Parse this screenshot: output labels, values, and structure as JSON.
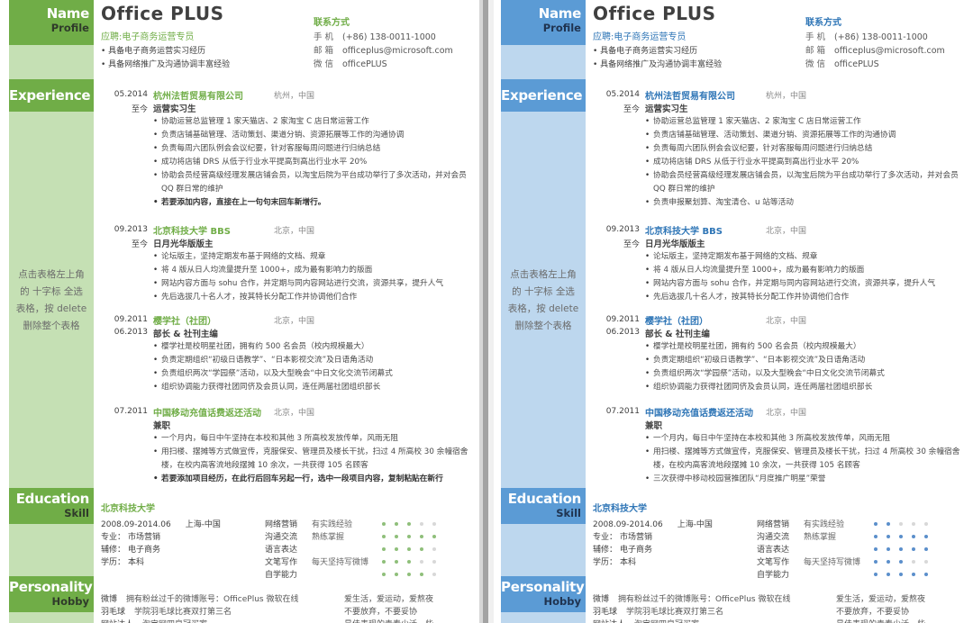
{
  "pages": [
    {
      "theme": "green",
      "accent_color": "#70ad47",
      "sidebar_color": "#c5e0b4",
      "sections": {
        "name": {
          "title": "Name",
          "subtitle": "Profile"
        },
        "experience": {
          "title": "Experience"
        },
        "education": {
          "title": "Education",
          "subtitle": "Skill"
        },
        "personality": {
          "title": "Personality",
          "subtitle": "Hobby"
        }
      },
      "sidebar_note": [
        "点击表格左上角",
        "的 十字标 全选",
        "表格，按 delete",
        "删除整个表格"
      ],
      "name": "Office PLUS",
      "job_target": "应聘:电子商务运营专员",
      "highlights": [
        "具备电子商务运营实习经历",
        "具备网络推广及沟通协调丰富经验"
      ],
      "contact": {
        "title": "联系方式",
        "rows": [
          {
            "label": "手 机",
            "value": "(+86) 138-0011-1000"
          },
          {
            "label": "邮 箱",
            "value": "officeplus@microsoft.com"
          },
          {
            "label": "微 信",
            "value": "officePLUS"
          }
        ]
      },
      "experience": [
        {
          "date_start": "05.2014",
          "date_end": "至今",
          "org": "杭州法哲贸易有限公司",
          "location": "杭州，中国",
          "role": "运营实习生",
          "bullets": [
            "协助运营总监管理 1 家天猫店、2 家淘宝 C 店日常运营工作",
            "负责店铺基础管理、活动策划、渠道分销、资源拓展等工作的沟通协调",
            "负责每周六团队例会会议纪要，针对客服每周问题进行归纳总结",
            "成功将店铺 DRS 从低于行业水平提高到高出行业水平 20%",
            "协助会员经营高级经理发展店铺会员，以淘宝后院为平台成功举行了多次活动，并对会员 QQ 群日常的维护",
            "若要添加内容，直接在上一句句末回车新增行。"
          ],
          "bold_last": true
        },
        {
          "date_start": "09.2013",
          "date_end": "至今",
          "org": "北京科技大学 BBS",
          "location": "北京，中国",
          "role": "日月光华版版主",
          "bullets": [
            "论坛版主，坚持定期发布基于网络的文档、规章",
            "将 4 版从日人均流量提升至 1000+，成为最有影响力的版面",
            "网站内容方面与 sohu 合作，并定期与同内容网站进行交流，资源共享，提升人气",
            "先后选拔几十名人才，按其特长分配工作并协调他们合作"
          ],
          "bold_last": false
        },
        {
          "date_start": "09.2011",
          "date_end": "06.2013",
          "org": "樱学社（社团）",
          "location": "北京，中国",
          "role": "部长 & 社刊主编",
          "bullets": [
            "樱学社是校明星社团，拥有约 500 名会员（校内规模最大）",
            "负责定期组织“初级日语教学”、“日本影视交流”及日语角活动",
            "负责组织两次“学园祭”活动，以及大型晚会“中日文化交流节闭幕式",
            "组织协调能力获得社团同侪及会员认同，连任两届社团组织部长"
          ],
          "bold_last": false
        },
        {
          "date_start": "07.2011",
          "date_end": "",
          "org": "中国移动充值话费返还活动",
          "location": "北京，中国",
          "role": "兼职",
          "bullets": [
            "一个月内，每日中午坚持在本校和其他 3 所高校发放传单，风雨无阻",
            "用扫楼、摆摊等方式做宣传，克服保安、管理员及楼长干扰，扫过 4 所高校 30 余幢宿舍楼，在校内高客流地段摆摊 10 余次，一共获得 105 名顾客",
            "若要添加项目经历，在此行后回车另起一行，选中一段项目内容，复制粘贴在新行"
          ],
          "bold_last": true
        }
      ],
      "education": {
        "school": "北京科技大学",
        "period": "2008.09-2014.06",
        "place": "上海-中国",
        "rows": [
          {
            "label": "专业：",
            "value": "市场营销"
          },
          {
            "label": "辅修：",
            "value": "电子商务"
          },
          {
            "label": "学历：",
            "value": "本科"
          }
        ]
      },
      "skills": [
        {
          "name": "网络营销",
          "desc": "有实践经验",
          "level": 3,
          "max": 5
        },
        {
          "name": "沟通交流",
          "desc": "熟练掌握",
          "level": 5,
          "max": 5
        },
        {
          "name": "语言表达",
          "desc": "",
          "level": 4,
          "max": 5
        },
        {
          "name": "文笔写作",
          "desc": "每天坚持写微博",
          "level": 3,
          "max": 5
        },
        {
          "name": "自学能力",
          "desc": "",
          "level": 4,
          "max": 5
        }
      ],
      "hobbies": [
        {
          "key": "微博",
          "value": "拥有粉丝过千的微博账号：OfficePlus 微软在线"
        },
        {
          "key": "羽毛球",
          "value": "学院羽毛球比赛双打第三名"
        },
        {
          "key": "网站达人",
          "value": "淘宝网四皇冠买家"
        }
      ],
      "personality": [
        "爱生活，爱运动，爱熬夜",
        "不要放弃，不要妥协",
        "最佳表现的青春少活一些"
      ]
    },
    {
      "theme": "blue",
      "accent_color": "#2e75b6",
      "sidebar_color": "#bdd7ee",
      "sections": {
        "name": {
          "title": "Name",
          "subtitle": "Profile"
        },
        "experience": {
          "title": "Experience"
        },
        "education": {
          "title": "Education",
          "subtitle": "Skill"
        },
        "personality": {
          "title": "Personality",
          "subtitle": "Hobby"
        }
      },
      "sidebar_note": [
        "点击表格左上角",
        "的 十字标 全选",
        "表格，按 delete",
        "删除整个表格"
      ],
      "name": "Office PLUS",
      "job_target": "应聘:电子商务运营专员",
      "highlights": [
        "具备电子商务运营实习经历",
        "具备网络推广及沟通协调丰富经验"
      ],
      "contact": {
        "title": "联系方式",
        "rows": [
          {
            "label": "手 机",
            "value": "(+86) 138-0011-1000"
          },
          {
            "label": "邮 箱",
            "value": "officeplus@microsoft.com"
          },
          {
            "label": "微 信",
            "value": "officePLUS"
          }
        ]
      },
      "experience": [
        {
          "date_start": "05.2014",
          "date_end": "至今",
          "org": "杭州法哲贸易有限公司",
          "location": "杭州，中国",
          "role": "运营实习生",
          "bullets": [
            "协助运营总监管理 1 家天猫店、2 家淘宝 C 店日常运营工作",
            "负责店铺基础管理、活动策划、渠道分销、资源拓展等工作的沟通协调",
            "负责每周六团队例会会议纪要，针对客服每周问题进行归纳总结",
            "成功将店铺 DRS 从低于行业水平提高到高出行业水平 20%",
            "协助会员经营高级经理发展店铺会员，以淘宝后院为平台成功举行了多次活动，并对会员 QQ 群日常的维护",
            "负责申报聚划算、淘宝清仓、u 站等活动"
          ],
          "bold_last": false
        },
        {
          "date_start": "09.2013",
          "date_end": "至今",
          "org": "北京科技大学 BBS",
          "location": "北京，中国",
          "role": "日月光华版版主",
          "bullets": [
            "论坛版主，坚持定期发布基于网络的文档、规章",
            "将 4 版从日人均流量提升至 1000+，成为最有影响力的版面",
            "网站内容方面与 sohu 合作，并定期与同内容网站进行交流，资源共享，提升人气",
            "先后选拔几十名人才，按其特长分配工作并协调他们合作"
          ],
          "bold_last": false
        },
        {
          "date_start": "09.2011",
          "date_end": "06.2013",
          "org": "樱学社（社团）",
          "location": "北京，中国",
          "role": "部长 & 社刊主编",
          "bullets": [
            "樱学社是校明星社团，拥有约 500 名会员（校内规模最大）",
            "负责定期组织“初级日语教学”、“日本影视交流”及日语角活动",
            "负责组织两次“学园祭”活动，以及大型晚会“中日文化交流节闭幕式",
            "组织协调能力获得社团同侪及会员认同，连任两届社团组织部长"
          ],
          "bold_last": false
        },
        {
          "date_start": "07.2011",
          "date_end": "",
          "org": "中国移动充值话费返还活动",
          "location": "北京，中国",
          "role": "兼职",
          "bullets": [
            "一个月内，每日中午坚持在本校和其他 3 所高校发放传单，风雨无阻",
            "用扫楼、摆摊等方式做宣传，克服保安、管理员及楼长干扰，扫过 4 所高校 30 余幢宿舍楼，在校内高客流地段摆摊 10 余次，一共获得 105 名顾客",
            "三次获得中移动校园营推团队“月度推广明星”荣誉"
          ],
          "bold_last": false
        }
      ],
      "education": {
        "school": "北京科技大学",
        "period": "2008.09-2014.06",
        "place": "上海-中国",
        "rows": [
          {
            "label": "专业：",
            "value": "市场营销"
          },
          {
            "label": "辅修：",
            "value": "电子商务"
          },
          {
            "label": "学历：",
            "value": "本科"
          }
        ]
      },
      "skills": [
        {
          "name": "网络营销",
          "desc": "有实践经验",
          "level": 2,
          "max": 5
        },
        {
          "name": "沟通交流",
          "desc": "熟练掌握",
          "level": 5,
          "max": 5
        },
        {
          "name": "语言表达",
          "desc": "",
          "level": 5,
          "max": 5
        },
        {
          "name": "文笔写作",
          "desc": "每天坚持写微博",
          "level": 3,
          "max": 5
        },
        {
          "name": "自学能力",
          "desc": "",
          "level": 5,
          "max": 5
        }
      ],
      "hobbies": [
        {
          "key": "微博",
          "value": "拥有粉丝过千的微博账号：OfficePlus 微软在线"
        },
        {
          "key": "羽毛球",
          "value": "学院羽毛球比赛双打第三名"
        },
        {
          "key": "网站达人",
          "value": "淘宝网四皇冠买家"
        }
      ],
      "personality": [
        "爱生活，爱运动，爱熬夜",
        "不要放弃，不要妥协",
        "最佳表现的青春少活一些"
      ]
    }
  ]
}
